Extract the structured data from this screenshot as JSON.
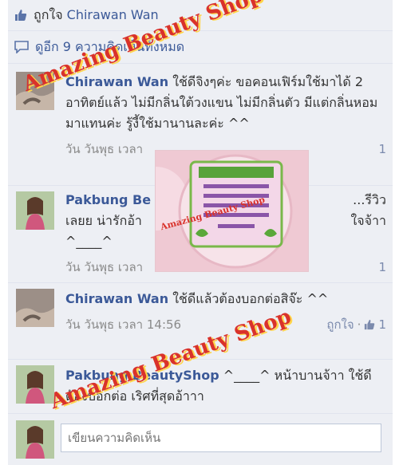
{
  "like_line": {
    "prefix": "ถูกใจ",
    "name": "Chirawan Wan"
  },
  "view_more": "ดูอีก 9 ความคิดเห็นทั้งหมด",
  "comments": [
    {
      "name": "Chirawan Wan",
      "text": " ใช้ดีจิงๆค่ะ ขอคอนเฟิร์มใช้มาได้ 2 อาทิตย์แล้ว ไม่มีกลิ่นใต้วงแขน ไม่มีกลิ่นตัว มีแต่กลิ่นหอมมาแทนค่ะ รู้งี้ใช้มานานละค่ะ ^^",
      "meta_time": "วัน วันพุธ เวลา",
      "meta_count": "1"
    },
    {
      "name": "Pakbung Be",
      "text_line1_tail": "...รีวิว",
      "text_line2": "เลยย น่ารักอ้า",
      "text_line2_tail": "ใจจ้าา",
      "text_line3": "^____^",
      "meta_time": "วัน วันพุธ เวลา",
      "meta_count": "1"
    },
    {
      "name": "Chirawan Wan",
      "text": " ใช้ดีแล้วต้องบอกต่อสิจ๊ะ ^^",
      "meta_time": "วัน วันพุธ เวลา 14:56",
      "meta_like": "ถูกใจ",
      "meta_count": "1"
    },
    {
      "name": "Pakbung BeautyShop",
      "text": " ^____^ หน้าบานจ้าา ใช้ดีต้องบอกต่อ เริศที่สุดอ้าาา"
    }
  ],
  "composer": {
    "placeholder": "เขียนความคิดเห็น"
  },
  "watermark": "Amazing Beauty Shop",
  "product_label": "Amazing Beauty Shop",
  "colors": {
    "panel": "#edeff4",
    "link": "#3b5998",
    "watermark": "#d9322b"
  }
}
